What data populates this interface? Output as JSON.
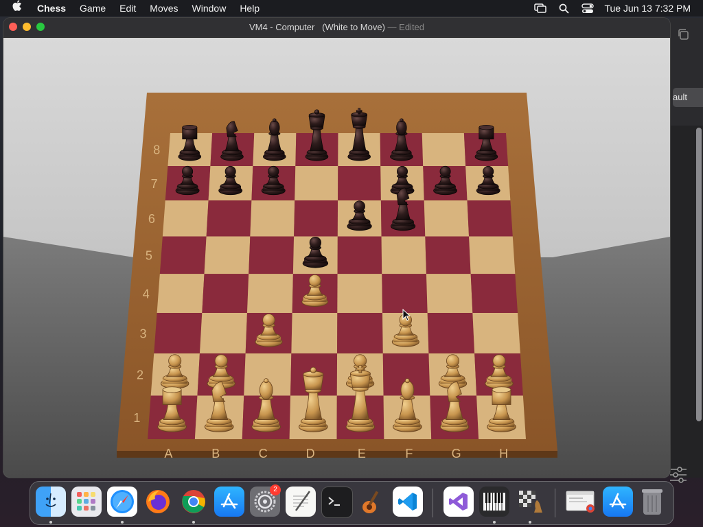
{
  "menubar": {
    "app_name": "Chess",
    "items": [
      "Game",
      "Edit",
      "Moves",
      "Window",
      "Help"
    ],
    "clock": "Tue Jun 13  7:32 PM"
  },
  "window": {
    "title": "VM4 - Computer   (White to Move)",
    "separator": " — ",
    "status": "Edited"
  },
  "background_window": {
    "button_partial": "ault"
  },
  "board": {
    "files": [
      "A",
      "B",
      "C",
      "D",
      "E",
      "F",
      "G",
      "H"
    ],
    "ranks": [
      "8",
      "7",
      "6",
      "5",
      "4",
      "3",
      "2",
      "1"
    ],
    "colors": {
      "light": "#d8b47e",
      "dark": "#8a2a3c",
      "frame": "#9a6230",
      "white_piece": "#c8954e",
      "black_piece": "#2e1c1c"
    },
    "pieces": [
      {
        "square": "a8",
        "color": "black",
        "type": "rook"
      },
      {
        "square": "b8",
        "color": "black",
        "type": "knight"
      },
      {
        "square": "c8",
        "color": "black",
        "type": "bishop"
      },
      {
        "square": "d8",
        "color": "black",
        "type": "queen"
      },
      {
        "square": "e8",
        "color": "black",
        "type": "king"
      },
      {
        "square": "f8",
        "color": "black",
        "type": "bishop"
      },
      {
        "square": "h8",
        "color": "black",
        "type": "rook"
      },
      {
        "square": "a7",
        "color": "black",
        "type": "pawn"
      },
      {
        "square": "b7",
        "color": "black",
        "type": "pawn"
      },
      {
        "square": "c7",
        "color": "black",
        "type": "pawn"
      },
      {
        "square": "f7",
        "color": "black",
        "type": "pawn"
      },
      {
        "square": "g7",
        "color": "black",
        "type": "pawn"
      },
      {
        "square": "h7",
        "color": "black",
        "type": "pawn"
      },
      {
        "square": "e6",
        "color": "black",
        "type": "pawn"
      },
      {
        "square": "f6",
        "color": "black",
        "type": "knight"
      },
      {
        "square": "d5",
        "color": "black",
        "type": "pawn"
      },
      {
        "square": "d4",
        "color": "white",
        "type": "pawn"
      },
      {
        "square": "c3",
        "color": "white",
        "type": "pawn"
      },
      {
        "square": "f3",
        "color": "white",
        "type": "pawn"
      },
      {
        "square": "a2",
        "color": "white",
        "type": "pawn"
      },
      {
        "square": "b2",
        "color": "white",
        "type": "pawn"
      },
      {
        "square": "e2",
        "color": "white",
        "type": "pawn"
      },
      {
        "square": "g2",
        "color": "white",
        "type": "pawn"
      },
      {
        "square": "h2",
        "color": "white",
        "type": "pawn"
      },
      {
        "square": "a1",
        "color": "white",
        "type": "rook"
      },
      {
        "square": "b1",
        "color": "white",
        "type": "knight"
      },
      {
        "square": "c1",
        "color": "white",
        "type": "bishop"
      },
      {
        "square": "d1",
        "color": "white",
        "type": "queen"
      },
      {
        "square": "e1",
        "color": "white",
        "type": "king"
      },
      {
        "square": "f1",
        "color": "white",
        "type": "bishop"
      },
      {
        "square": "g1",
        "color": "white",
        "type": "knight"
      },
      {
        "square": "h1",
        "color": "white",
        "type": "rook"
      }
    ]
  },
  "dock": {
    "apps": [
      {
        "name": "finder",
        "running": true
      },
      {
        "name": "launchpad",
        "running": false
      },
      {
        "name": "safari",
        "running": true
      },
      {
        "name": "firefox",
        "running": false
      },
      {
        "name": "chrome",
        "running": true
      },
      {
        "name": "app-store",
        "running": false
      },
      {
        "name": "system-settings",
        "running": false,
        "badge": "2"
      },
      {
        "name": "textedit",
        "running": false
      },
      {
        "name": "terminal",
        "running": false
      },
      {
        "name": "garageband",
        "running": false
      },
      {
        "name": "vscode",
        "running": false
      },
      {
        "name": "visual-studio",
        "running": false
      },
      {
        "name": "piano",
        "running": true
      },
      {
        "name": "chess",
        "running": true
      },
      {
        "name": "chrome-window",
        "running": false
      },
      {
        "name": "app-store-2",
        "running": false
      },
      {
        "name": "trash",
        "running": false
      }
    ]
  }
}
